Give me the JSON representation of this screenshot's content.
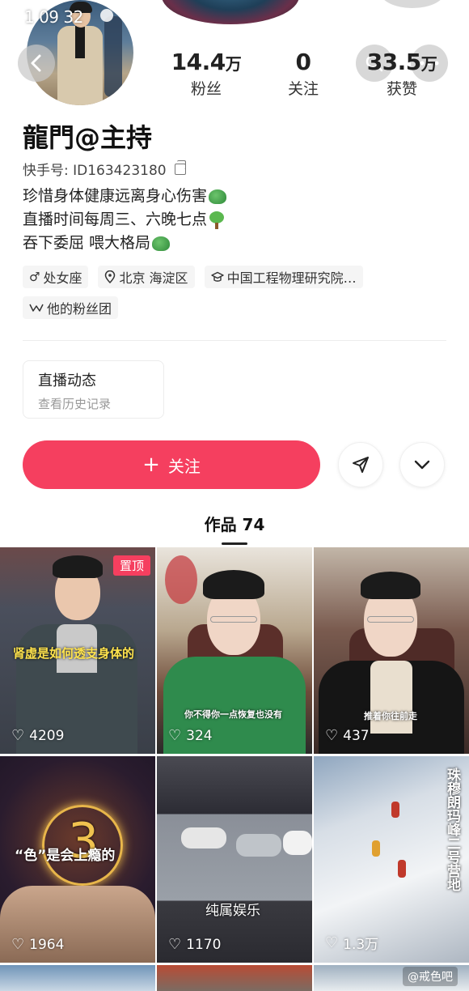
{
  "status": {
    "time": "1 09 32"
  },
  "profile": {
    "name": "龍門@主持",
    "id_label": "快手号: ID163423180",
    "bio": [
      "珍惜身体健康远离身心伤害",
      "直播时间每周三、六晚七点",
      "吞下委屈 喂大格局"
    ],
    "tags": [
      "处女座",
      "北京 海淀区",
      "中国工程物理研究院…",
      "他的粉丝团"
    ]
  },
  "stats": {
    "fans": {
      "value": "14.4",
      "unit": "万",
      "label": "粉丝"
    },
    "following": {
      "value": "0",
      "unit": "",
      "label": "关注"
    },
    "likes": {
      "value": "33.5",
      "unit": "万",
      "label": "获赞"
    }
  },
  "live": {
    "title": "直播动态",
    "subtitle": "查看历史记录"
  },
  "actions": {
    "follow_label": "关注"
  },
  "works": {
    "tab_label": "作品 74"
  },
  "videos": [
    {
      "likes": "4209",
      "caption": "肾虚是如何透支身体的",
      "pinned": "置顶"
    },
    {
      "likes": "324",
      "caption": "你不得你一点恢复也没有"
    },
    {
      "likes": "437",
      "caption": "推着你往前走"
    },
    {
      "likes": "1964",
      "caption": "“色”是会上瘾的",
      "number": "3"
    },
    {
      "likes": "1170",
      "caption": "纯属娱乐"
    },
    {
      "likes": "1.3万",
      "caption": "珠穆朗玛峰二号营地"
    }
  ],
  "watermark": "@戒色吧"
}
